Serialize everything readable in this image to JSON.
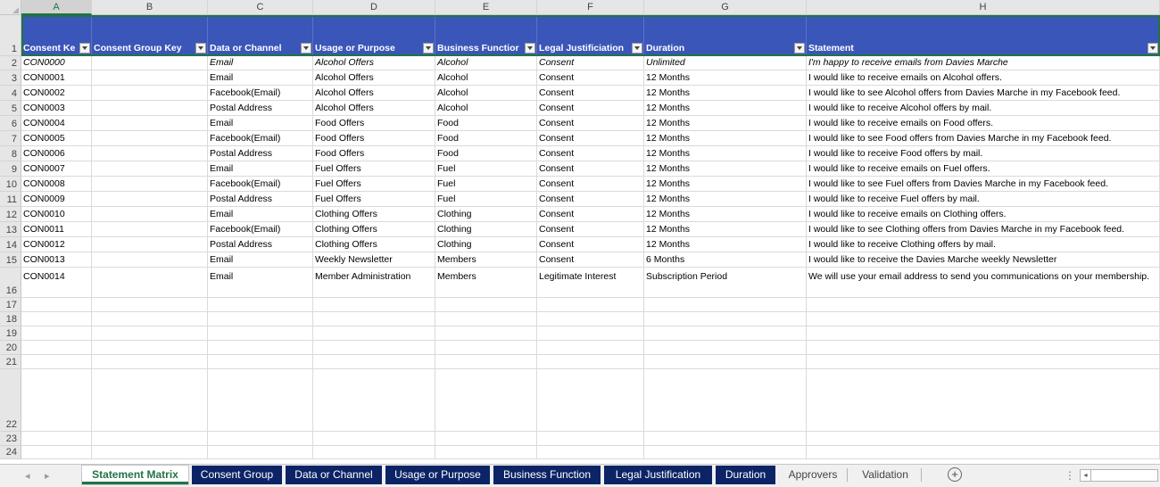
{
  "columns": [
    "A",
    "B",
    "C",
    "D",
    "E",
    "F",
    "G",
    "H"
  ],
  "selected_column": "A",
  "header_row_number": "1",
  "headers": [
    "Consent Ke",
    "Consent Group Key",
    "Data or Channel",
    "Usage or Purpose",
    "Business Functior",
    "Legal Justificiation",
    "Duration",
    "Statement"
  ],
  "rows": [
    {
      "n": "2",
      "cells": [
        "CON0000",
        "",
        "Email",
        "Alcohol Offers",
        "Alcohol",
        "Consent",
        "Unlimited",
        "I'm happy to receive emails from Davies Marche"
      ]
    },
    {
      "n": "3",
      "cells": [
        "CON0001",
        "",
        "Email",
        "Alcohol Offers",
        "Alcohol",
        "Consent",
        "12 Months",
        "I would like to receive emails on Alcohol offers."
      ]
    },
    {
      "n": "4",
      "cells": [
        "CON0002",
        "",
        "Facebook(Email)",
        "Alcohol Offers",
        "Alcohol",
        "Consent",
        "12 Months",
        "I would like to see Alcohol offers from Davies Marche in my Facebook feed."
      ]
    },
    {
      "n": "5",
      "cells": [
        "CON0003",
        "",
        "Postal Address",
        "Alcohol Offers",
        "Alcohol",
        "Consent",
        "12 Months",
        "I would like to receive Alcohol offers by mail."
      ]
    },
    {
      "n": "6",
      "cells": [
        "CON0004",
        "",
        "Email",
        "Food Offers",
        "Food",
        "Consent",
        "12 Months",
        "I would like to receive emails on Food offers."
      ]
    },
    {
      "n": "7",
      "cells": [
        "CON0005",
        "",
        "Facebook(Email)",
        "Food Offers",
        "Food",
        "Consent",
        "12 Months",
        "I would like to see Food offers from Davies Marche in my Facebook feed."
      ]
    },
    {
      "n": "8",
      "cells": [
        "CON0006",
        "",
        "Postal Address",
        "Food Offers",
        "Food",
        "Consent",
        "12 Months",
        "I would like to receive Food offers by mail."
      ]
    },
    {
      "n": "9",
      "cells": [
        "CON0007",
        "",
        "Email",
        "Fuel Offers",
        "Fuel",
        "Consent",
        "12 Months",
        "I would like to receive emails on Fuel offers."
      ]
    },
    {
      "n": "10",
      "cells": [
        "CON0008",
        "",
        "Facebook(Email)",
        "Fuel Offers",
        "Fuel",
        "Consent",
        "12 Months",
        "I would like to see Fuel offers from Davies Marche in my Facebook feed."
      ]
    },
    {
      "n": "11",
      "cells": [
        "CON0009",
        "",
        "Postal Address",
        "Fuel Offers",
        "Fuel",
        "Consent",
        "12 Months",
        "I would like to receive Fuel offers by mail."
      ]
    },
    {
      "n": "12",
      "cells": [
        "CON0010",
        "",
        "Email",
        "Clothing Offers",
        "Clothing",
        "Consent",
        "12 Months",
        "I would like to receive emails on Clothing offers."
      ]
    },
    {
      "n": "13",
      "cells": [
        "CON0011",
        "",
        "Facebook(Email)",
        "Clothing Offers",
        "Clothing",
        "Consent",
        "12 Months",
        "I would like to see Clothing offers from Davies Marche in my Facebook feed."
      ]
    },
    {
      "n": "14",
      "cells": [
        "CON0012",
        "",
        "Postal Address",
        "Clothing Offers",
        "Clothing",
        "Consent",
        "12 Months",
        "I would like to receive Clothing offers by mail."
      ]
    },
    {
      "n": "15",
      "cells": [
        "CON0013",
        "",
        "Email",
        "Weekly Newsletter",
        "Members",
        "Consent",
        "6 Months",
        "I would like to receive the Davies Marche weekly Newsletter"
      ]
    },
    {
      "n": "16",
      "cells": [
        "CON0014",
        "",
        "Email",
        "Member Administration",
        "Members",
        "Legitimate Interest",
        "Subscription Period",
        "We will use your email address to send you communications on your membership."
      ]
    },
    {
      "n": "17",
      "cells": [
        "",
        "",
        "",
        "",
        "",
        "",
        "",
        ""
      ]
    },
    {
      "n": "18",
      "cells": [
        "",
        "",
        "",
        "",
        "",
        "",
        "",
        ""
      ]
    },
    {
      "n": "19",
      "cells": [
        "",
        "",
        "",
        "",
        "",
        "",
        "",
        ""
      ]
    },
    {
      "n": "20",
      "cells": [
        "",
        "",
        "",
        "",
        "",
        "",
        "",
        ""
      ]
    },
    {
      "n": "21",
      "cells": [
        "",
        "",
        "",
        "",
        "",
        "",
        "",
        ""
      ]
    },
    {
      "n": "22",
      "cells": [
        "",
        "",
        "",
        "",
        "",
        "",
        "",
        ""
      ]
    },
    {
      "n": "23",
      "cells": [
        "",
        "",
        "",
        "",
        "",
        "",
        "",
        ""
      ]
    },
    {
      "n": "24",
      "cells": [
        "",
        "",
        "",
        "",
        "",
        "",
        "",
        ""
      ]
    }
  ],
  "tabs": [
    {
      "label": "Statement Matrix",
      "style": "active"
    },
    {
      "label": "Consent Group",
      "style": "navy"
    },
    {
      "label": "Data or Channel",
      "style": "navy"
    },
    {
      "label": "Usage or Purpose",
      "style": "navy"
    },
    {
      "label": "Business Function",
      "style": "navy"
    },
    {
      "label": "Legal Justification",
      "style": "navy"
    },
    {
      "label": "Duration",
      "style": "navy"
    },
    {
      "label": "Approvers",
      "style": "plain"
    },
    {
      "label": "Validation",
      "style": "plain"
    }
  ],
  "colors": {
    "header_fill": "#3a56b8",
    "tab_navy": "#0c2466",
    "excel_green": "#217346"
  }
}
